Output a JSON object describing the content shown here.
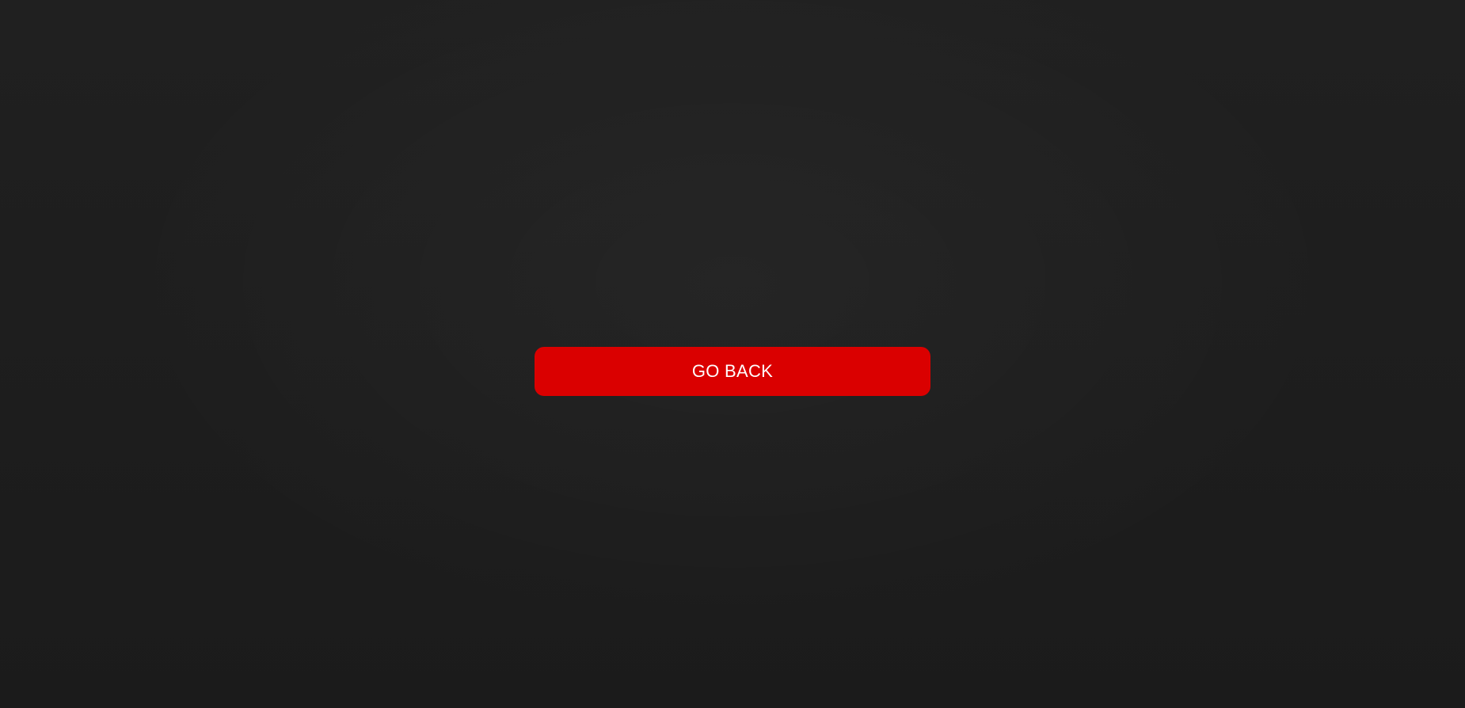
{
  "page": {
    "background_color": "#1d1d1d"
  },
  "go_back": {
    "label": "GO BACK",
    "color": "#da0000",
    "text_color": "#ffffff"
  }
}
